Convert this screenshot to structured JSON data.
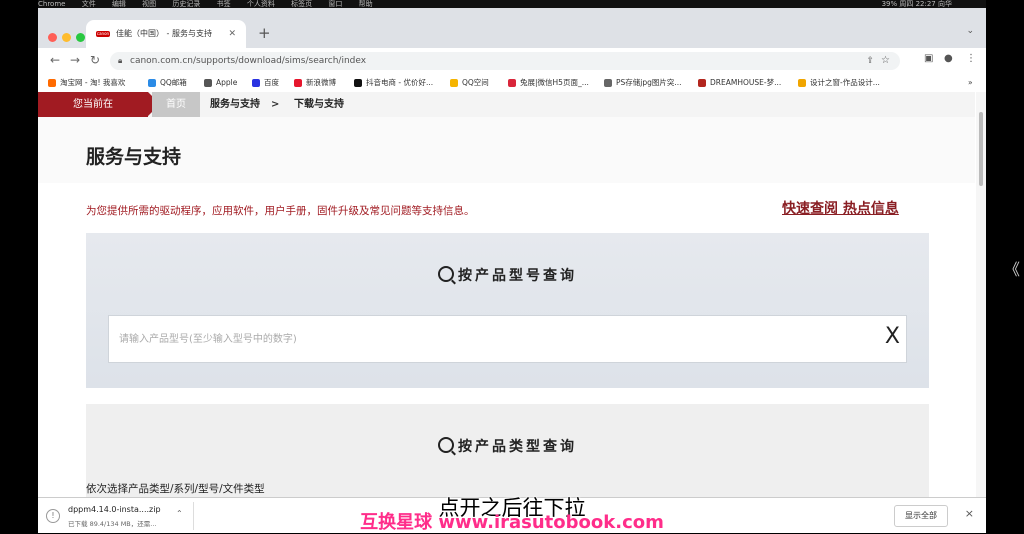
{
  "system_menu": {
    "app": "Chrome",
    "items": [
      "文件",
      "编辑",
      "视图",
      "历史记录",
      "书签",
      "个人资料",
      "标签页",
      "窗口",
      "帮助"
    ],
    "status": "39% 周四 22:27 向华"
  },
  "browser": {
    "tab_title": "佳能（中国） - 服务与支持",
    "tab_favicon": "canon",
    "new_tab": "+",
    "url": "canon.com.cn/supports/download/sims/search/index",
    "bookmarks": [
      {
        "label": "淘宝网 - 淘! 我喜欢",
        "color": "#ff6a00"
      },
      {
        "label": "QQ邮箱",
        "color": "#2b8be6"
      },
      {
        "label": "Apple",
        "color": "#555555"
      },
      {
        "label": "百度",
        "color": "#2932e1"
      },
      {
        "label": "新浪微博",
        "color": "#e6162d"
      },
      {
        "label": "抖音电商 - 优价好...",
        "color": "#111111"
      },
      {
        "label": "QQ空间",
        "color": "#f5b400"
      },
      {
        "label": "兔展|微信H5页面_...",
        "color": "#d9263b"
      },
      {
        "label": "PS存储jpg图片突...",
        "color": "#666666"
      },
      {
        "label": "DREAMHOUSE-梦...",
        "color": "#b3261e"
      },
      {
        "label": "设计之窗-作品设计...",
        "color": "#f0a500"
      }
    ],
    "bookmarks_more": "»"
  },
  "page": {
    "breadcrumb": {
      "here": "您当前在",
      "home": "首页",
      "level1": "服务与支持",
      "separator": ">",
      "level2": "下载与支持"
    },
    "heading": "服务与支持",
    "intro": "为您提供所需的驱动程序，应用软件，用户手册，固件升级及常见问题等支持信息。",
    "quick_links": "快速查阅 热点信息",
    "search_model": {
      "title": "按产品型号查询",
      "placeholder": "请输入产品型号(至少输入型号中的数字)",
      "clear": "X"
    },
    "search_type": {
      "title": "按产品类型查询",
      "hint": "依次选择产品类型/系列/型号/文件类型"
    }
  },
  "downloads_bar": {
    "file_name": "dppm4.14.0-insta....zip",
    "status": "已下载 89.4/134 MB，还需...",
    "show_all": "显示全部",
    "close": "×"
  },
  "overlay": {
    "subtitle": "点开之后往下拉",
    "watermark": "互换星球 www.irasutobook.com",
    "side_arrow": "《"
  }
}
